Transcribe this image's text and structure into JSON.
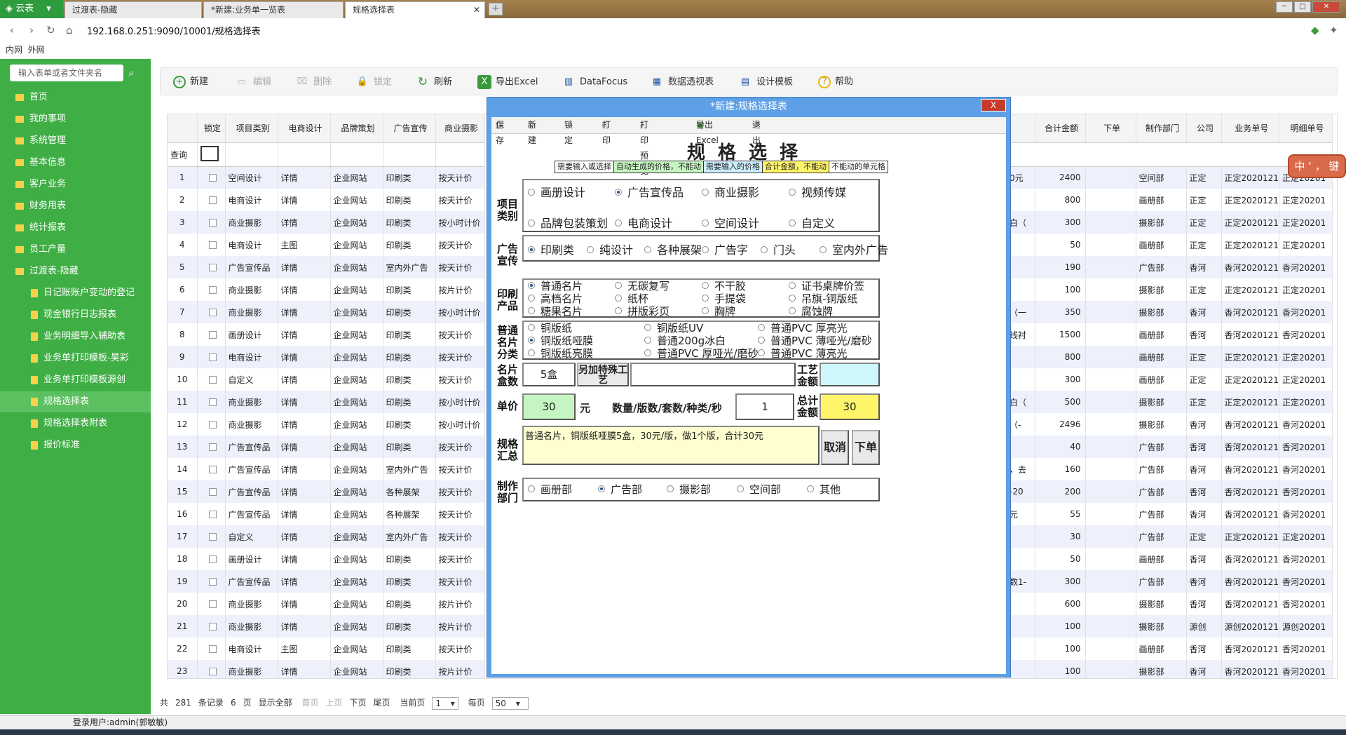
{
  "app": {
    "name": "云表"
  },
  "tabs": [
    {
      "label": "过渡表-隐藏"
    },
    {
      "label": "*新建:业务单一览表"
    },
    {
      "label": "规格选择表",
      "active": true
    }
  ],
  "address": {
    "url": "192.168.0.251:9090/10001/规格选择表"
  },
  "network": {
    "intranet": "内网",
    "extranet": "外网"
  },
  "sidebar": {
    "search_placeholder": "输入表单或者文件夹名",
    "items": [
      {
        "label": "首页",
        "level": 0
      },
      {
        "label": "我的事项",
        "level": 0
      },
      {
        "label": "系统管理",
        "level": 0
      },
      {
        "label": "基本信息",
        "level": 0
      },
      {
        "label": "客户业务",
        "level": 0
      },
      {
        "label": "财务用表",
        "level": 0
      },
      {
        "label": "统计报表",
        "level": 0
      },
      {
        "label": "员工产量",
        "level": 0
      },
      {
        "label": "过渡表-隐藏",
        "level": 0
      },
      {
        "label": "日记账账户变动的登记",
        "level": 1
      },
      {
        "label": "现金银行日志报表",
        "level": 1
      },
      {
        "label": "业务明细导入辅助表",
        "level": 1
      },
      {
        "label": "业务单打印模板-昊彩",
        "level": 1
      },
      {
        "label": "业务单打印模板源创",
        "level": 1
      },
      {
        "label": "规格选择表",
        "level": 1,
        "active": true
      },
      {
        "label": "规格选择表附表",
        "level": 1
      },
      {
        "label": "报价标准",
        "level": 1
      }
    ]
  },
  "toolbar": {
    "new": "新建",
    "edit": "编辑",
    "delete": "删除",
    "lock": "锁定",
    "refresh": "刷新",
    "export": "导出Excel",
    "datafocus": "DataFocus",
    "pivot": "数据透视表",
    "design": "设计模板",
    "help": "帮助"
  },
  "grid": {
    "headers": [
      "锁定",
      "项目类别",
      "电商设计",
      "品牌策划",
      "广告宣传",
      "商业摄影"
    ],
    "query_label": "查询",
    "rows": [
      [
        "1",
        "空间设计",
        "详情",
        "企业网站",
        "印刷类",
        "按天计价"
      ],
      [
        "2",
        "电商设计",
        "详情",
        "企业网站",
        "印刷类",
        "按天计价"
      ],
      [
        "3",
        "商业摄影",
        "详情",
        "企业网站",
        "印刷类",
        "按小时计价"
      ],
      [
        "4",
        "电商设计",
        "主图",
        "企业网站",
        "印刷类",
        "按天计价"
      ],
      [
        "5",
        "广告宣传品",
        "详情",
        "企业网站",
        "室内外广告",
        "按天计价"
      ],
      [
        "6",
        "商业摄影",
        "详情",
        "企业网站",
        "印刷类",
        "按片计价"
      ],
      [
        "7",
        "商业摄影",
        "详情",
        "企业网站",
        "印刷类",
        "按小时计价"
      ],
      [
        "8",
        "画册设计",
        "详情",
        "企业网站",
        "印刷类",
        "按天计价"
      ],
      [
        "9",
        "电商设计",
        "详情",
        "企业网站",
        "印刷类",
        "按天计价"
      ],
      [
        "10",
        "自定义",
        "详情",
        "企业网站",
        "印刷类",
        "按天计价"
      ],
      [
        "11",
        "商业摄影",
        "详情",
        "企业网站",
        "印刷类",
        "按小时计价"
      ],
      [
        "12",
        "商业摄影",
        "详情",
        "企业网站",
        "印刷类",
        "按小时计价"
      ],
      [
        "13",
        "广告宣传品",
        "详情",
        "企业网站",
        "印刷类",
        "按天计价"
      ],
      [
        "14",
        "广告宣传品",
        "详情",
        "企业网站",
        "室内外广告",
        "按天计价"
      ],
      [
        "15",
        "广告宣传品",
        "详情",
        "企业网站",
        "各种展架",
        "按天计价"
      ],
      [
        "16",
        "广告宣传品",
        "详情",
        "企业网站",
        "各种展架",
        "按天计价"
      ],
      [
        "17",
        "自定义",
        "详情",
        "企业网站",
        "室内外广告",
        "按天计价"
      ],
      [
        "18",
        "画册设计",
        "详情",
        "企业网站",
        "印刷类",
        "按天计价"
      ],
      [
        "19",
        "广告宣传品",
        "详情",
        "企业网站",
        "印刷类",
        "按天计价"
      ],
      [
        "20",
        "商业摄影",
        "详情",
        "企业网站",
        "印刷类",
        "按片计价"
      ],
      [
        "21",
        "商业摄影",
        "详情",
        "企业网站",
        "印刷类",
        "按片计价"
      ],
      [
        "22",
        "电商设计",
        "主图",
        "企业网站",
        "印刷类",
        "按天计价"
      ],
      [
        "23",
        "商业摄影",
        "详情",
        "企业网站",
        "印刷类",
        "按片计价"
      ]
    ],
    "right_headers": [
      "合计金额",
      "下单",
      "制作部门",
      "公司",
      "业务单号",
      "明细单号"
    ],
    "right_rows": [
      [
        "0元",
        "2400",
        "",
        "空间部",
        "正定",
        "正定2020121",
        "正定20201"
      ],
      [
        "",
        "800",
        "",
        "画册部",
        "正定",
        "正定2020121",
        "正定20201"
      ],
      [
        "白（",
        "300",
        "",
        "摄影部",
        "正定",
        "正定2020121",
        "正定20201"
      ],
      [
        "",
        "50",
        "",
        "画册部",
        "正定",
        "正定2020121",
        "正定20201"
      ],
      [
        "",
        "190",
        "",
        "广告部",
        "香河",
        "香河2020121",
        "香河20201"
      ],
      [
        "",
        "100",
        "",
        "摄影部",
        "正定",
        "正定2020121",
        "正定20201"
      ],
      [
        "（一",
        "350",
        "",
        "摄影部",
        "香河",
        "香河2020121",
        "香河20201"
      ],
      [
        "线衬",
        "1500",
        "",
        "画册部",
        "香河",
        "香河2020121",
        "香河20201"
      ],
      [
        "",
        "800",
        "",
        "画册部",
        "正定",
        "正定2020121",
        "正定20201"
      ],
      [
        "",
        "300",
        "",
        "画册部",
        "正定",
        "正定2020121",
        "正定20201"
      ],
      [
        "白（",
        "500",
        "",
        "摄影部",
        "正定",
        "正定2020121",
        "正定20201"
      ],
      [
        "（-",
        "2496",
        "",
        "摄影部",
        "香河",
        "香河2020121",
        "香河20201"
      ],
      [
        "",
        "40",
        "",
        "广告部",
        "香河",
        "香河2020121",
        "香河20201"
      ],
      [
        "，去",
        "160",
        "",
        "广告部",
        "香河",
        "香河2020121",
        "香河20201"
      ],
      [
        "-20",
        "200",
        "",
        "广告部",
        "香河",
        "香河2020121",
        "香河20201"
      ],
      [
        "元",
        "55",
        "",
        "广告部",
        "香河",
        "香河2020121",
        "香河20201"
      ],
      [
        "",
        "30",
        "",
        "广告部",
        "正定",
        "正定2020121",
        "正定20201"
      ],
      [
        "",
        "50",
        "",
        "画册部",
        "香河",
        "香河2020121",
        "香河20201"
      ],
      [
        "数1-",
        "300",
        "",
        "广告部",
        "香河",
        "香河2020121",
        "香河20201"
      ],
      [
        "",
        "600",
        "",
        "摄影部",
        "香河",
        "香河2020121",
        "香河20201"
      ],
      [
        "",
        "100",
        "",
        "摄影部",
        "源创",
        "源创2020121",
        "源创20201"
      ],
      [
        "",
        "100",
        "",
        "画册部",
        "香河",
        "香河2020121",
        "香河20201"
      ],
      [
        "",
        "100",
        "",
        "摄影部",
        "香河",
        "香河2020121",
        "香河20201"
      ]
    ]
  },
  "pager": {
    "total_prefix": "共",
    "total": "281",
    "records": "条记录",
    "pages": "6",
    "page_unit": "页",
    "show_all": "显示全部",
    "first": "首页",
    "prev": "上页",
    "next": "下页",
    "last": "尾页",
    "current_label": "当前页",
    "current": "1",
    "per_page_label": "每页",
    "per_page": "50"
  },
  "status": {
    "user": "登录用户:admin(郭敏敏)"
  },
  "floatkey": {
    "label": "中 ‘ ， 键"
  },
  "modal": {
    "title": "*新建:规格选择表",
    "close": "X",
    "toolbar": {
      "save": "保存",
      "new": "新建",
      "lock": "锁定",
      "print": "打印",
      "preview": "打印预览",
      "export": "导出Excel",
      "exit": "退出"
    },
    "form_title": "规格选择",
    "legend": [
      "需要输入或选择",
      "自动生成的价格，不能动",
      "需要输入的价格",
      "合计金额，不能动",
      "不能动的单元格"
    ],
    "colors": {
      "legend1": "#ffffff",
      "legend2": "#c5f5c0",
      "legend3": "#cdeefd",
      "legend4": "#fff56b",
      "legend5": "#ffffff"
    },
    "sections": {
      "project_type": "项目类别",
      "ad": "广告宣传",
      "print": "印刷产品",
      "card": "普通名片分类",
      "box_count": "名片盒数",
      "unit_price": "单价",
      "summary": "规格汇总",
      "department": "制作部门"
    },
    "project_type_options": [
      {
        "label": "画册设计"
      },
      {
        "label": "广告宣传品",
        "checked": true
      },
      {
        "label": "商业摄影"
      },
      {
        "label": "视频传媒"
      },
      {
        "label": "品牌包装策划"
      },
      {
        "label": "电商设计"
      },
      {
        "label": "空间设计"
      },
      {
        "label": "自定义"
      }
    ],
    "ad_options": [
      {
        "label": "印刷类",
        "checked": true
      },
      {
        "label": "纯设计"
      },
      {
        "label": "各种展架"
      },
      {
        "label": "广告字"
      },
      {
        "label": "门头"
      },
      {
        "label": "室内外广告"
      }
    ],
    "print_options": [
      {
        "label": "普通名片",
        "checked": true
      },
      {
        "label": "无碳复写"
      },
      {
        "label": "不干胶"
      },
      {
        "label": "证书桌牌价签"
      },
      {
        "label": "高档名片"
      },
      {
        "label": "纸杯"
      },
      {
        "label": "手提袋"
      },
      {
        "label": "吊旗-铜版纸"
      },
      {
        "label": "糖果名片"
      },
      {
        "label": "拼版彩页"
      },
      {
        "label": "胸牌"
      },
      {
        "label": "腐蚀牌"
      }
    ],
    "card_options": [
      {
        "label": "铜版纸"
      },
      {
        "label": "铜版纸UV"
      },
      {
        "label": "普通PVC 厚亮光"
      },
      {
        "label": "铜版纸哑膜",
        "checked": true
      },
      {
        "label": "普通200g冰白"
      },
      {
        "label": "普通PVC 薄哑光/磨砂"
      },
      {
        "label": "铜版纸亮膜"
      },
      {
        "label": "普通PVC 厚哑光/磨砂"
      },
      {
        "label": "普通PVC 薄亮光"
      }
    ],
    "box_count_value": "5盒",
    "special_label": "另加特殊工艺",
    "special_value": "",
    "craft_amount_label": "工艺金额",
    "craft_amount_value": "",
    "unit_price_value": "30",
    "unit_yuan": "元",
    "qty_label": "数量/版数/套数/种类/秒",
    "qty_value": "1",
    "total_label": "总计金额",
    "total_value": "30",
    "summary_text": "普通名片，铜版纸哑膜5盒，30元/版，做1个版，合计30元",
    "cancel": "取消",
    "order": "下单",
    "department_options": [
      {
        "label": "画册部"
      },
      {
        "label": "广告部",
        "checked": true
      },
      {
        "label": "摄影部"
      },
      {
        "label": "空间部"
      },
      {
        "label": "其他"
      }
    ]
  }
}
